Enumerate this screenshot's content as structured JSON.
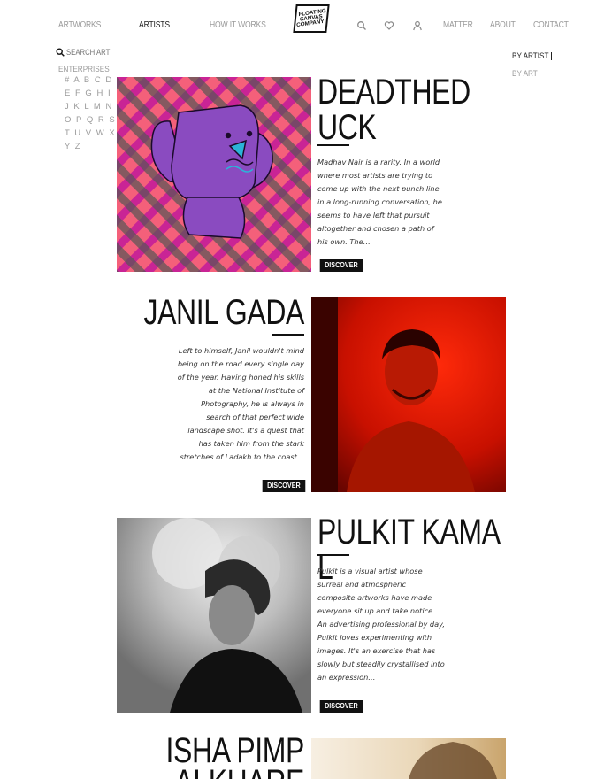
{
  "nav": {
    "left": [
      "ARTWORKS",
      "ARTISTS",
      "HOW IT WORKS"
    ],
    "logo": [
      "FLOATING",
      "CANVAS",
      "COMPANY"
    ],
    "right": [
      "MATTER",
      "ABOUT",
      "CONTACT"
    ],
    "icons": [
      "search-icon",
      "heart-icon",
      "user-icon"
    ]
  },
  "sidebar": {
    "search_placeholder": "SEARCH ARTISTS",
    "enterprises": "ENTERPRISES",
    "alphabet": [
      "# A B C D",
      "E F G H I",
      "J K L M N",
      "O P Q R S",
      "T U V W X",
      "Y Z"
    ]
  },
  "filters": [
    "BY ARTIST",
    "BY ART"
  ],
  "artists": [
    {
      "name": "DEADTHEDUCK",
      "blurb": "Madhav Nair is a rarity. In a world where most artists are trying to come up with the next punch line in a long-running conversation, he seems to have left that pursuit altogether and chosen a path of his own. The…",
      "cta": "DISCOVER"
    },
    {
      "name": "JANIL GADA",
      "blurb": "Left to himself, Janil wouldn't mind being on the road every single day of the year. Having honed his skills at the National Institute of Photography, he is always in search of that perfect wide landscape shot. It's a quest that has taken him from the stark stretches of Ladakh to the coast…",
      "cta": "DISCOVER"
    },
    {
      "name": "PULKIT KAMAL",
      "blurb": "Pulkit is a visual artist whose surreal and atmospheric composite artworks have made everyone sit up and take notice. An advertising professional by day, Pulkit loves experimenting with images. It's an exercise that has slowly but steadily crystallised into an expression…",
      "cta": "DISCOVER"
    },
    {
      "name": "ISHA PIMPALKHARE"
    }
  ],
  "colors": {
    "accent": "#111111",
    "muted_text": "#9a9a9a",
    "plaid_pink": "#f4607a",
    "plaid_magenta": "#c21a9a",
    "plaid_gray": "#555555",
    "creature_purple": "#8a4bc0"
  }
}
